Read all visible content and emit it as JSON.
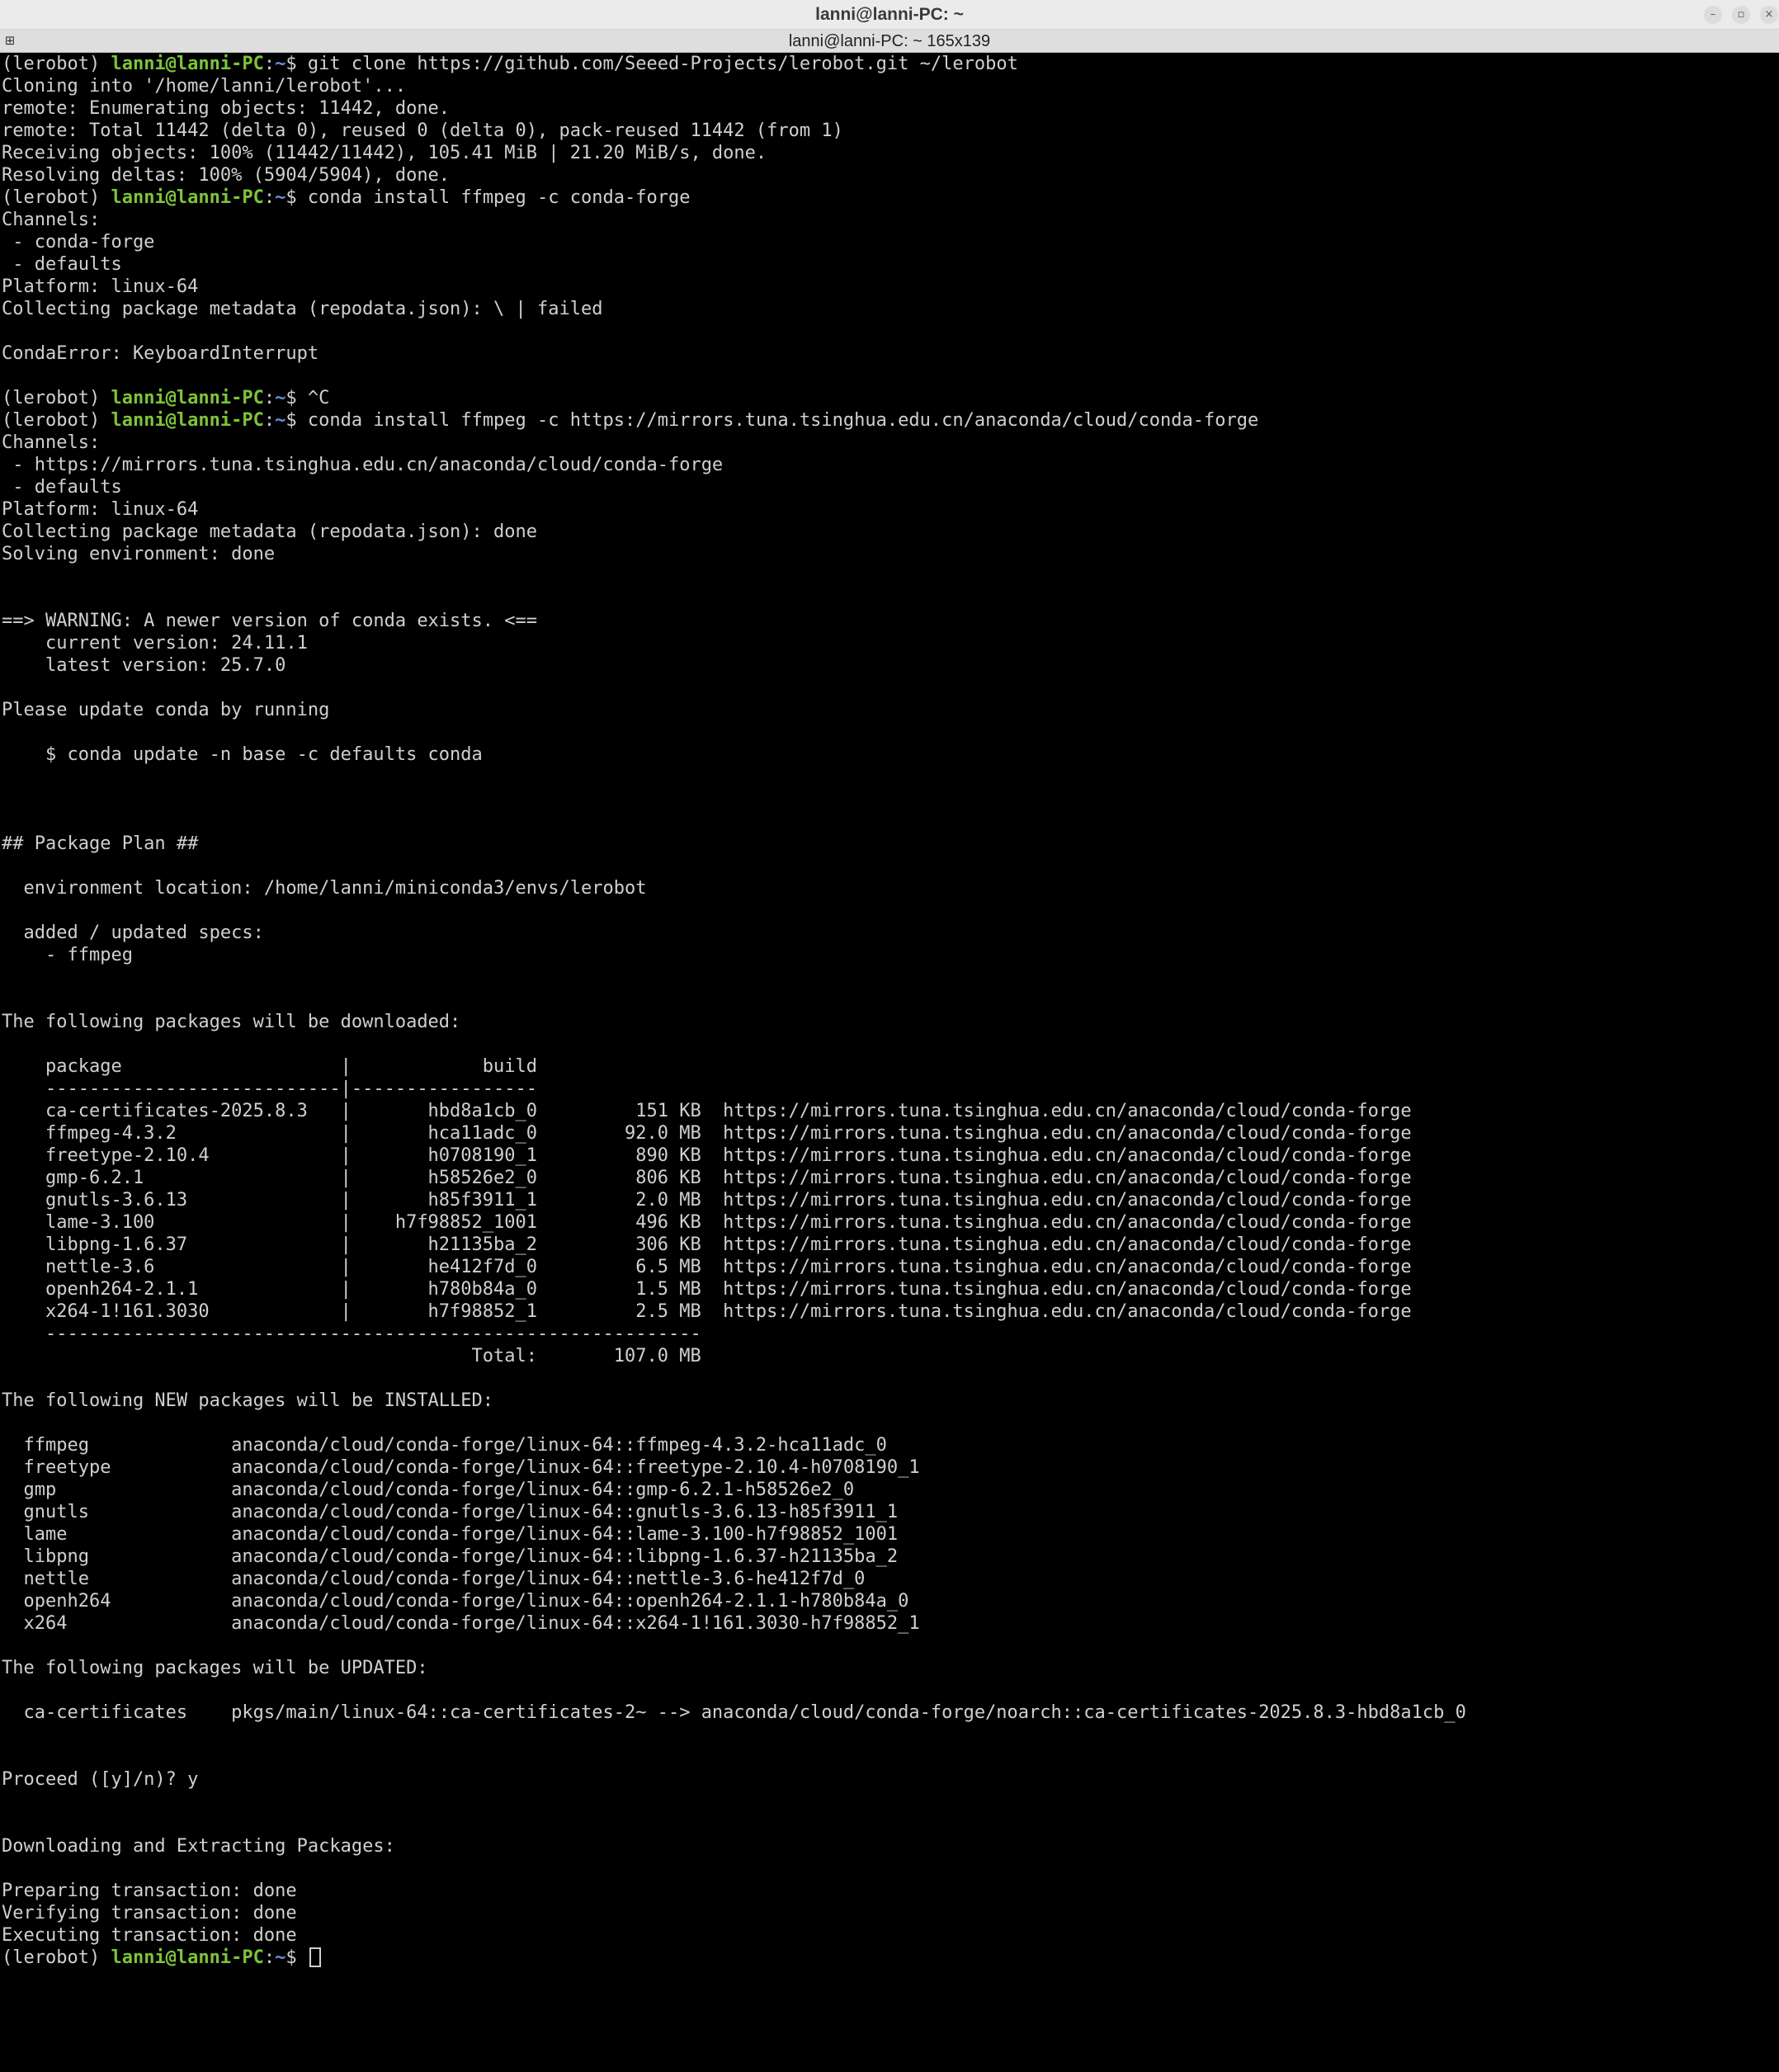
{
  "window": {
    "title": "lanni@lanni-PC: ~",
    "tab_title": "lanni@lanni-PC: ~ 165x139",
    "minimize_glyph": "–",
    "maximize_glyph": "▫",
    "close_glyph": "×",
    "tab_icon_glyph": "⊞"
  },
  "prompt": {
    "env": "(lerobot) ",
    "user_host": "lanni@lanni-PC",
    "colon": ":",
    "path": "~",
    "symbol": "$ "
  },
  "colors": {
    "background": "#000000",
    "text": "#d0d0d0",
    "prompt_user": "#7ec33a",
    "prompt_path": "#6b8ee0"
  },
  "lines": [
    {
      "prompt": true,
      "cmd": "git clone https://github.com/Seeed-Projects/lerobot.git ~/lerobot"
    },
    {
      "text": "Cloning into '/home/lanni/lerobot'..."
    },
    {
      "text": "remote: Enumerating objects: 11442, done."
    },
    {
      "text": "remote: Total 11442 (delta 0), reused 0 (delta 0), pack-reused 11442 (from 1)"
    },
    {
      "text": "Receiving objects: 100% (11442/11442), 105.41 MiB | 21.20 MiB/s, done."
    },
    {
      "text": "Resolving deltas: 100% (5904/5904), done."
    },
    {
      "prompt": true,
      "cmd": "conda install ffmpeg -c conda-forge"
    },
    {
      "text": "Channels:"
    },
    {
      "text": " - conda-forge"
    },
    {
      "text": " - defaults"
    },
    {
      "text": "Platform: linux-64"
    },
    {
      "text": "Collecting package metadata (repodata.json): \\ | failed"
    },
    {
      "text": ""
    },
    {
      "text": "CondaError: KeyboardInterrupt"
    },
    {
      "text": ""
    },
    {
      "prompt": true,
      "cmd": "^C"
    },
    {
      "prompt": true,
      "cmd": "conda install ffmpeg -c https://mirrors.tuna.tsinghua.edu.cn/anaconda/cloud/conda-forge"
    },
    {
      "text": "Channels:"
    },
    {
      "text": " - https://mirrors.tuna.tsinghua.edu.cn/anaconda/cloud/conda-forge"
    },
    {
      "text": " - defaults"
    },
    {
      "text": "Platform: linux-64"
    },
    {
      "text": "Collecting package metadata (repodata.json): done"
    },
    {
      "text": "Solving environment: done"
    },
    {
      "text": ""
    },
    {
      "text": ""
    },
    {
      "text": "==> WARNING: A newer version of conda exists. <=="
    },
    {
      "text": "    current version: 24.11.1"
    },
    {
      "text": "    latest version: 25.7.0"
    },
    {
      "text": ""
    },
    {
      "text": "Please update conda by running"
    },
    {
      "text": ""
    },
    {
      "text": "    $ conda update -n base -c defaults conda"
    },
    {
      "text": ""
    },
    {
      "text": ""
    },
    {
      "text": ""
    },
    {
      "text": "## Package Plan ##"
    },
    {
      "text": ""
    },
    {
      "text": "  environment location: /home/lanni/miniconda3/envs/lerobot"
    },
    {
      "text": ""
    },
    {
      "text": "  added / updated specs:"
    },
    {
      "text": "    - ffmpeg"
    },
    {
      "text": ""
    },
    {
      "text": ""
    },
    {
      "text": "The following packages will be downloaded:"
    },
    {
      "text": ""
    },
    {
      "text": "    package                    |            build"
    },
    {
      "text": "    ---------------------------|-----------------"
    },
    {
      "text": "    ca-certificates-2025.8.3   |       hbd8a1cb_0         151 KB  https://mirrors.tuna.tsinghua.edu.cn/anaconda/cloud/conda-forge"
    },
    {
      "text": "    ffmpeg-4.3.2               |       hca11adc_0        92.0 MB  https://mirrors.tuna.tsinghua.edu.cn/anaconda/cloud/conda-forge"
    },
    {
      "text": "    freetype-2.10.4            |       h0708190_1         890 KB  https://mirrors.tuna.tsinghua.edu.cn/anaconda/cloud/conda-forge"
    },
    {
      "text": "    gmp-6.2.1                  |       h58526e2_0         806 KB  https://mirrors.tuna.tsinghua.edu.cn/anaconda/cloud/conda-forge"
    },
    {
      "text": "    gnutls-3.6.13              |       h85f3911_1         2.0 MB  https://mirrors.tuna.tsinghua.edu.cn/anaconda/cloud/conda-forge"
    },
    {
      "text": "    lame-3.100                 |    h7f98852_1001         496 KB  https://mirrors.tuna.tsinghua.edu.cn/anaconda/cloud/conda-forge"
    },
    {
      "text": "    libpng-1.6.37              |       h21135ba_2         306 KB  https://mirrors.tuna.tsinghua.edu.cn/anaconda/cloud/conda-forge"
    },
    {
      "text": "    nettle-3.6                 |       he412f7d_0         6.5 MB  https://mirrors.tuna.tsinghua.edu.cn/anaconda/cloud/conda-forge"
    },
    {
      "text": "    openh264-2.1.1             |       h780b84a_0         1.5 MB  https://mirrors.tuna.tsinghua.edu.cn/anaconda/cloud/conda-forge"
    },
    {
      "text": "    x264-1!161.3030            |       h7f98852_1         2.5 MB  https://mirrors.tuna.tsinghua.edu.cn/anaconda/cloud/conda-forge"
    },
    {
      "text": "    ------------------------------------------------------------"
    },
    {
      "text": "                                           Total:       107.0 MB"
    },
    {
      "text": ""
    },
    {
      "text": "The following NEW packages will be INSTALLED:"
    },
    {
      "text": ""
    },
    {
      "text": "  ffmpeg             anaconda/cloud/conda-forge/linux-64::ffmpeg-4.3.2-hca11adc_0"
    },
    {
      "text": "  freetype           anaconda/cloud/conda-forge/linux-64::freetype-2.10.4-h0708190_1"
    },
    {
      "text": "  gmp                anaconda/cloud/conda-forge/linux-64::gmp-6.2.1-h58526e2_0"
    },
    {
      "text": "  gnutls             anaconda/cloud/conda-forge/linux-64::gnutls-3.6.13-h85f3911_1"
    },
    {
      "text": "  lame               anaconda/cloud/conda-forge/linux-64::lame-3.100-h7f98852_1001"
    },
    {
      "text": "  libpng             anaconda/cloud/conda-forge/linux-64::libpng-1.6.37-h21135ba_2"
    },
    {
      "text": "  nettle             anaconda/cloud/conda-forge/linux-64::nettle-3.6-he412f7d_0"
    },
    {
      "text": "  openh264           anaconda/cloud/conda-forge/linux-64::openh264-2.1.1-h780b84a_0"
    },
    {
      "text": "  x264               anaconda/cloud/conda-forge/linux-64::x264-1!161.3030-h7f98852_1"
    },
    {
      "text": ""
    },
    {
      "text": "The following packages will be UPDATED:"
    },
    {
      "text": ""
    },
    {
      "text": "  ca-certificates    pkgs/main/linux-64::ca-certificates-2~ --> anaconda/cloud/conda-forge/noarch::ca-certificates-2025.8.3-hbd8a1cb_0"
    },
    {
      "text": ""
    },
    {
      "text": ""
    },
    {
      "text": "Proceed ([y]/n)? y"
    },
    {
      "text": ""
    },
    {
      "text": ""
    },
    {
      "text": "Downloading and Extracting Packages:"
    },
    {
      "text": ""
    },
    {
      "text": "Preparing transaction: done"
    },
    {
      "text": "Verifying transaction: done"
    },
    {
      "text": "Executing transaction: done"
    },
    {
      "prompt": true,
      "cmd": "",
      "cursor": true
    }
  ]
}
